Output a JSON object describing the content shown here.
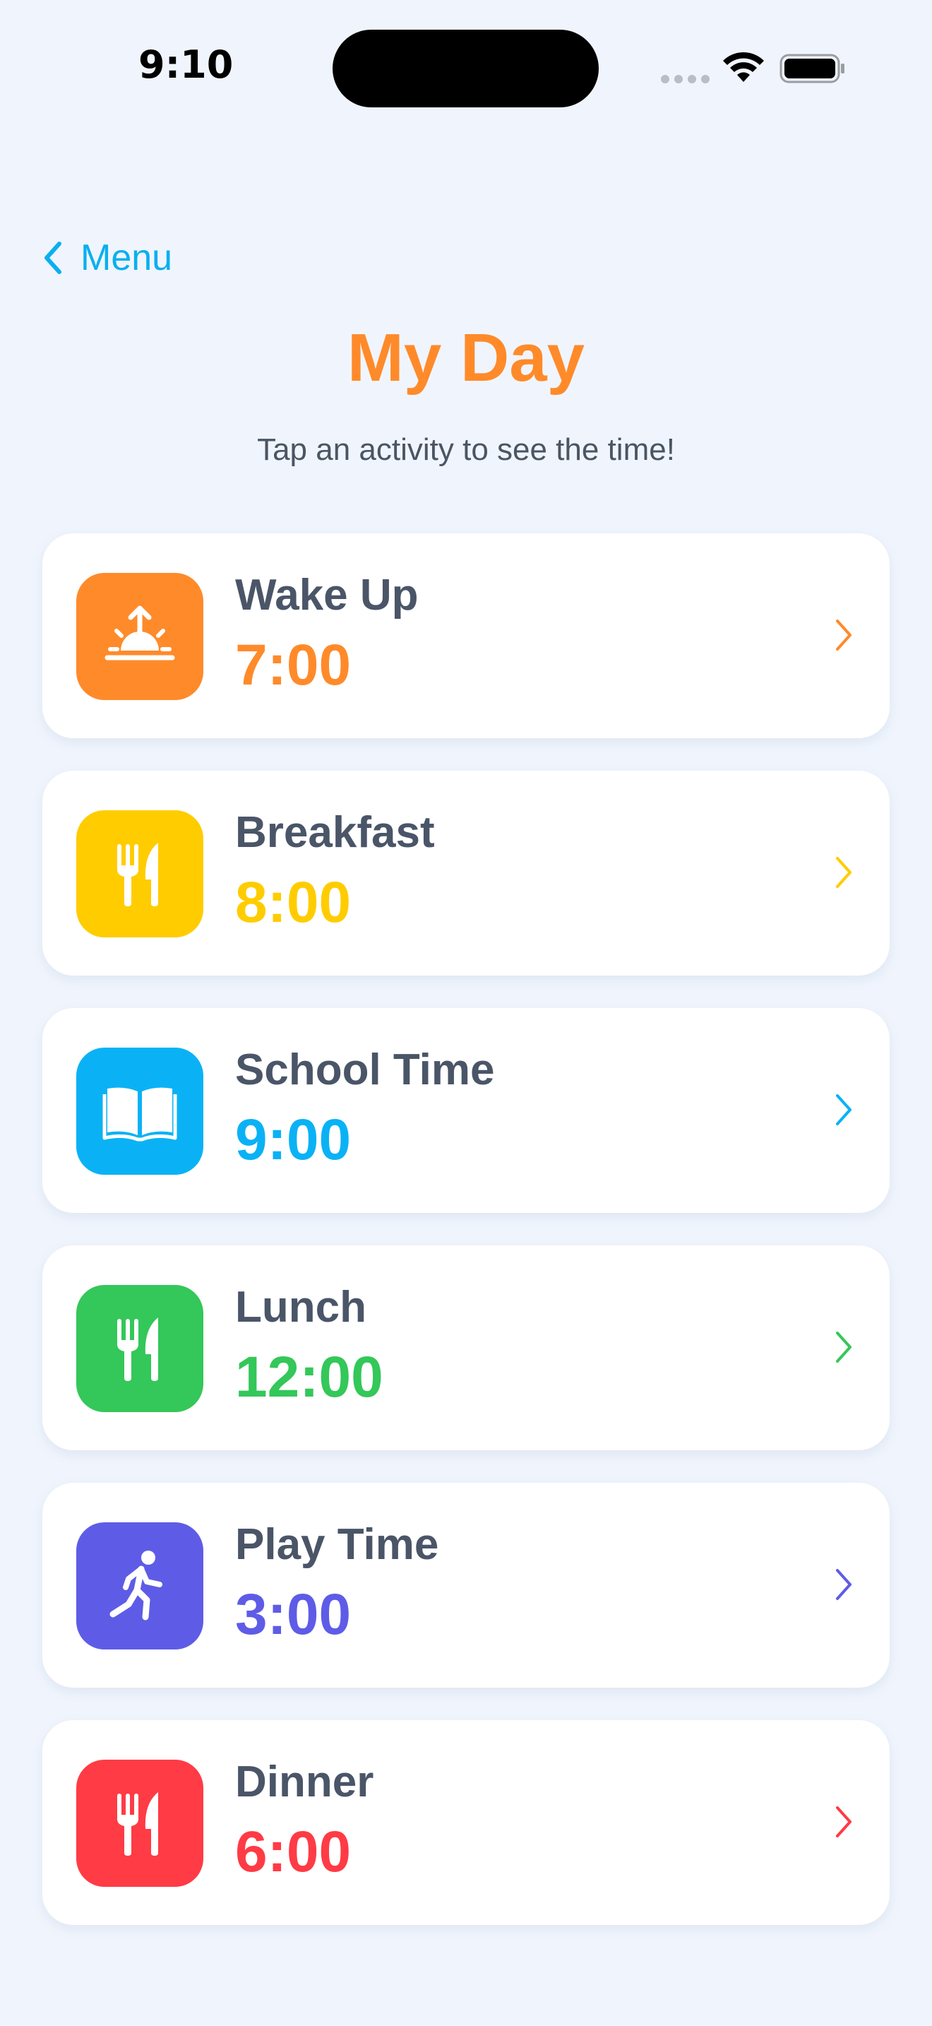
{
  "status_bar": {
    "time": "9:10"
  },
  "nav": {
    "back_label": "Menu",
    "accent_color": "#0AAFF0"
  },
  "header": {
    "title": "My Day",
    "subtitle": "Tap an activity to see the time!"
  },
  "activities": [
    {
      "label": "Wake Up",
      "time": "7:00",
      "icon": "sunrise-icon",
      "color": "#FF8A2A"
    },
    {
      "label": "Breakfast",
      "time": "8:00",
      "icon": "fork-knife-icon",
      "color": "#FFCC00"
    },
    {
      "label": "School Time",
      "time": "9:00",
      "icon": "book-icon",
      "color": "#0AB2F5"
    },
    {
      "label": "Lunch",
      "time": "12:00",
      "icon": "fork-knife-icon",
      "color": "#34C759"
    },
    {
      "label": "Play Time",
      "time": "3:00",
      "icon": "running-figure-icon",
      "color": "#5E5CE6"
    },
    {
      "label": "Dinner",
      "time": "6:00",
      "icon": "fork-knife-icon",
      "color": "#FF3B45"
    }
  ]
}
